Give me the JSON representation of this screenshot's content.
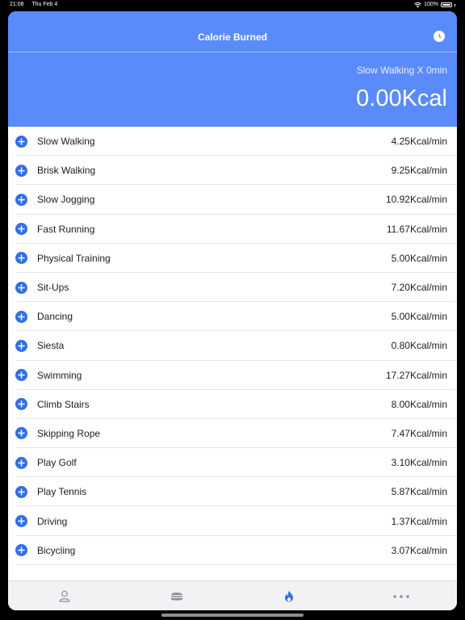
{
  "status": {
    "time": "21:08",
    "date": "Thu Feb 4",
    "battery": "100%"
  },
  "header": {
    "title": "Calorie Burned",
    "subtitle": "Slow Walking X 0min",
    "total": "0.00Kcal",
    "accent_color": "#5a8bfb"
  },
  "activities": [
    {
      "name": "Slow Walking",
      "rate": "4.25Kcal/min"
    },
    {
      "name": "Brisk Walking",
      "rate": "9.25Kcal/min"
    },
    {
      "name": "Slow Jogging",
      "rate": "10.92Kcal/min"
    },
    {
      "name": "Fast Running",
      "rate": "11.67Kcal/min"
    },
    {
      "name": "Physical Training",
      "rate": "5.00Kcal/min"
    },
    {
      "name": "Sit-Ups",
      "rate": "7.20Kcal/min"
    },
    {
      "name": "Dancing",
      "rate": "5.00Kcal/min"
    },
    {
      "name": "Siesta",
      "rate": "0.80Kcal/min"
    },
    {
      "name": "Swimming",
      "rate": "17.27Kcal/min"
    },
    {
      "name": "Climb Stairs",
      "rate": "8.00Kcal/min"
    },
    {
      "name": "Skipping Rope",
      "rate": "7.47Kcal/min"
    },
    {
      "name": "Play Golf",
      "rate": "3.10Kcal/min"
    },
    {
      "name": "Play Tennis",
      "rate": "5.87Kcal/min"
    },
    {
      "name": "Driving",
      "rate": "1.37Kcal/min"
    },
    {
      "name": "Bicycling",
      "rate": "3.07Kcal/min"
    }
  ],
  "tabs": [
    {
      "icon": "person-icon",
      "active": false
    },
    {
      "icon": "burger-icon",
      "active": false
    },
    {
      "icon": "flame-icon",
      "active": true
    },
    {
      "icon": "more-icon",
      "active": false
    }
  ]
}
